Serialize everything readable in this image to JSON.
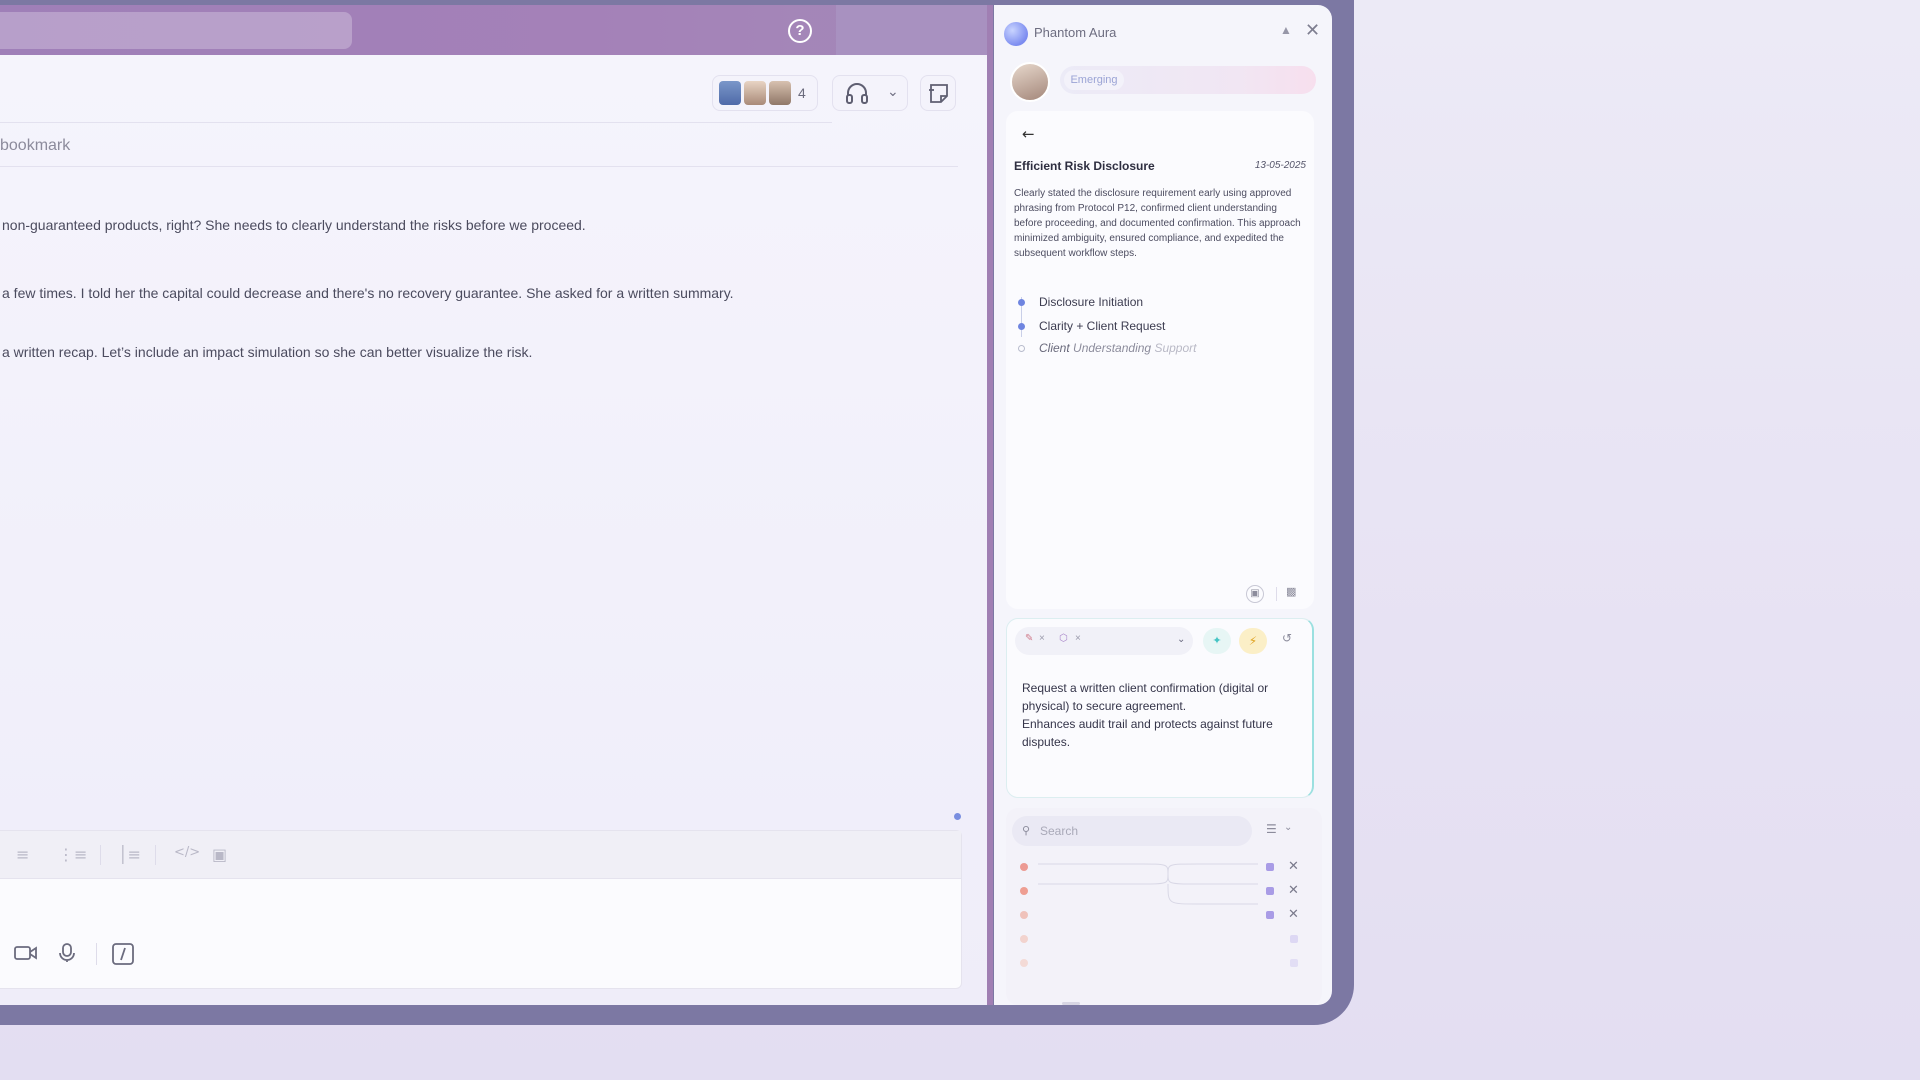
{
  "header": {
    "help_label": "?",
    "avatar_count": "4"
  },
  "main": {
    "bookmark_placeholder": "bookmark",
    "messages": [
      "non-guaranteed products, right? She needs to clearly understand the risks before we proceed.",
      "a few times. I told her the capital could decrease and there's no recovery guarantee. She asked for a written summary.",
      "a written recap. Let’s include an impact simulation so she can better visualize the risk."
    ]
  },
  "composer": {
    "toolbar_icons": [
      "ordered-list-icon",
      "bullet-list-icon",
      "quote-icon",
      "code-icon",
      "code-block-icon"
    ],
    "bottom_icons": [
      "video-icon",
      "microphone-icon",
      "slash-command-icon"
    ]
  },
  "assistant": {
    "title": "Phantom  Aura",
    "level_label": "Emerging",
    "card": {
      "title": "Efficient Risk Disclosure",
      "date": "13-05-2025",
      "description": "Clearly stated the disclosure requirement early using approved phrasing  from Protocol P12, confirmed client understanding before proceeding, and documented confirmation. This approach minimized ambiguity, ensured  compliance, and expedited the subsequent workflow steps.",
      "steps": [
        {
          "label": "Disclosure Initiation"
        },
        {
          "label": "Clarity + Client Request"
        },
        {
          "label_a": "Client",
          "label_b": "Understanding",
          "label_c": "Support"
        }
      ]
    },
    "suggestion": {
      "text_line1": "Request a written client confirmation (digital or physical) to secure agreement.",
      "text_line2": "Enhances audit trail and protects against future disputes."
    },
    "search": {
      "placeholder": "Search"
    }
  },
  "colors": {
    "accent_purple": "#a07fb3",
    "frame": "#7c78a3",
    "link_blue": "#7a8ee0",
    "teal": "#43c4c4",
    "amber": "#e0a322"
  }
}
